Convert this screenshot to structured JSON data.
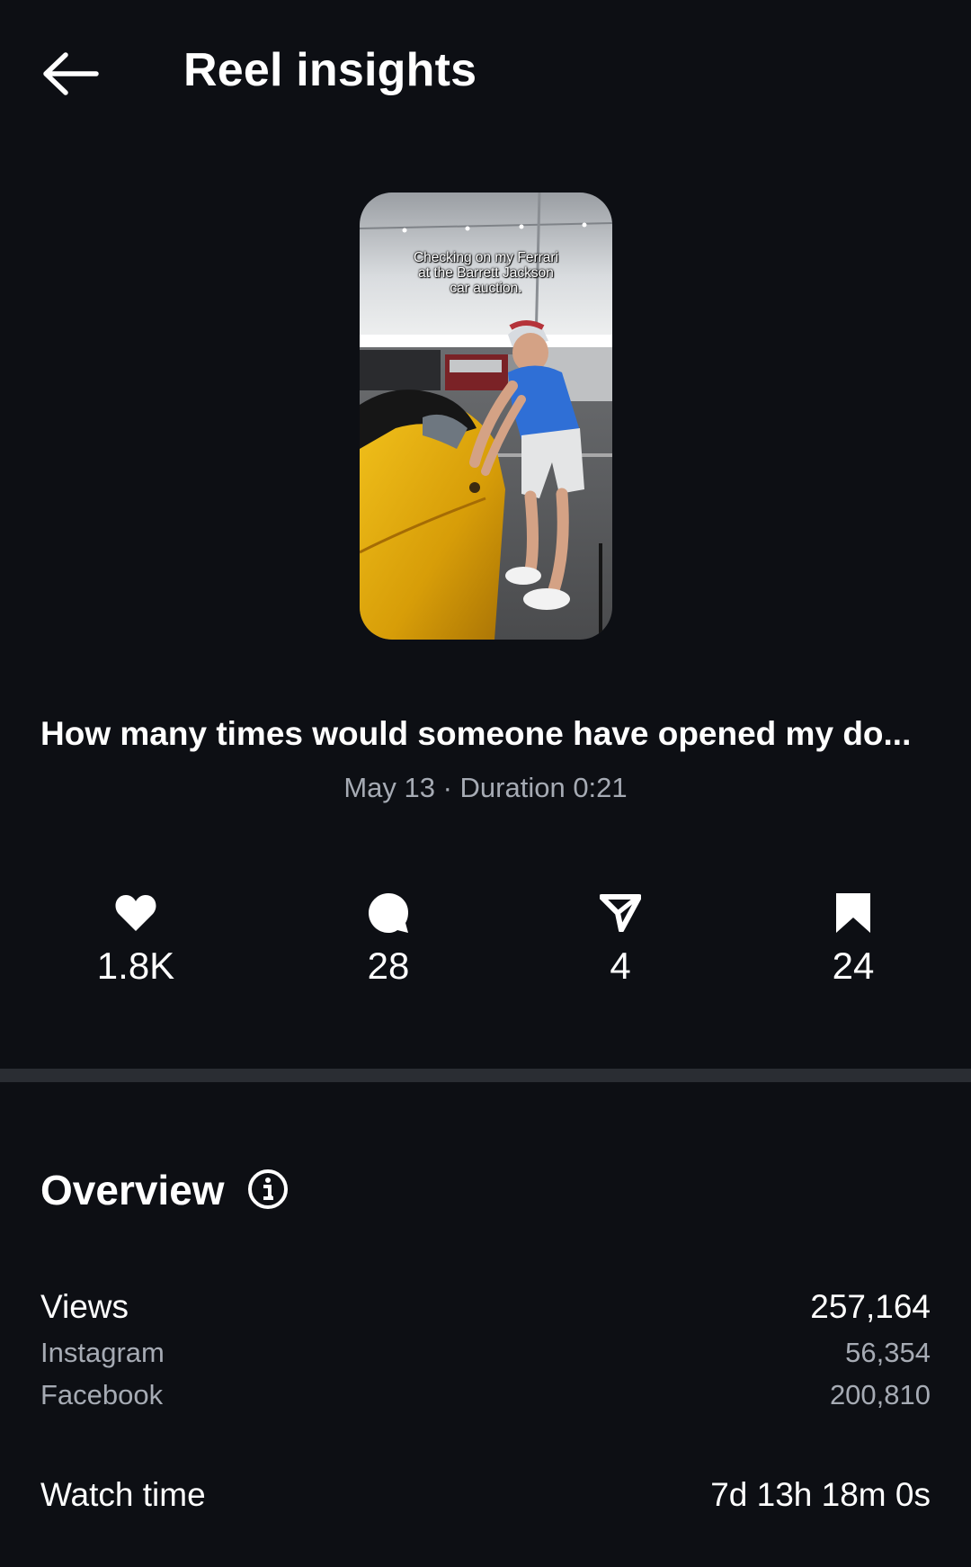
{
  "header": {
    "title": "Reel insights",
    "back_icon": "arrow-left-icon"
  },
  "reel": {
    "thumbnail_caption": "Checking on my Ferrari\nat the Barrett Jackson\ncar auction.",
    "title": "How many times would someone have opened my do...",
    "meta": "May 13 · Duration 0:21"
  },
  "stats": [
    {
      "icon": "heart-icon",
      "value": "1.8K"
    },
    {
      "icon": "comment-icon",
      "value": "28"
    },
    {
      "icon": "share-icon",
      "value": "4"
    },
    {
      "icon": "bookmark-icon",
      "value": "24"
    }
  ],
  "overview": {
    "title": "Overview",
    "info_icon": "info-icon",
    "views_label": "Views",
    "views_value": "257,164",
    "instagram_label": "Instagram",
    "instagram_value": "56,354",
    "facebook_label": "Facebook",
    "facebook_value": "200,810",
    "watch_time_label": "Watch time",
    "watch_time_value": "7d 13h 18m 0s"
  },
  "colors": {
    "background": "#0d0f14",
    "text_primary": "#ffffff",
    "text_secondary": "#a6abb4",
    "divider": "#2a2d33"
  }
}
